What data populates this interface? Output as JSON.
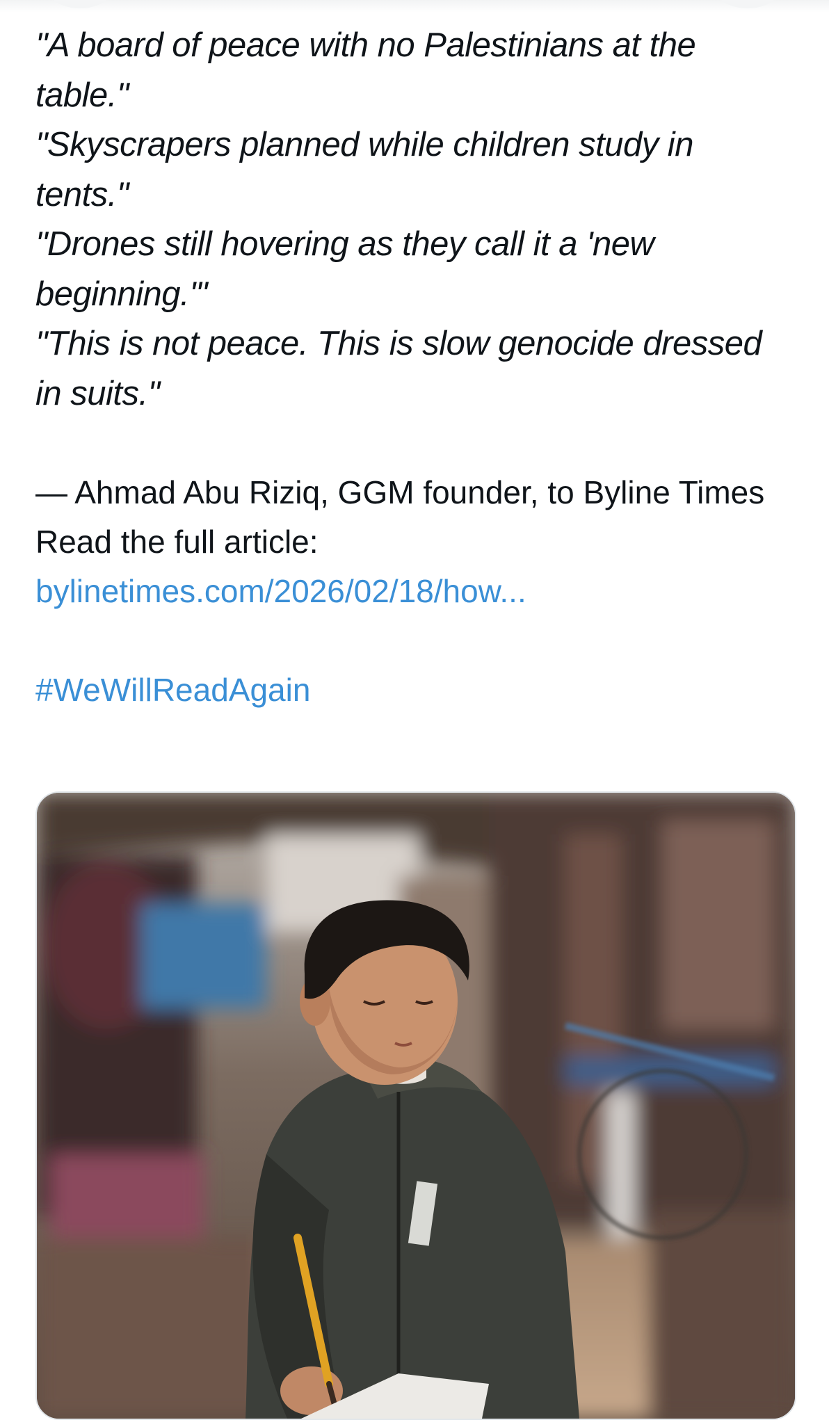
{
  "tweet": {
    "quotes": [
      "\"A board of peace with no Palestinians at the table.\"",
      "\"Skyscrapers planned while children study in tents.\"",
      "\"Drones still hovering as they call it a 'new beginning.'\"",
      "\"This is not peace. This is slow genocide dressed in suits.\""
    ],
    "attribution": "— Ahmad Abu Riziq, GGM founder, to Byline Times",
    "read_full": "Read the full article:",
    "link": "bylinetimes.com/2026/02/18/how...",
    "hashtag": "#WeWillReadAgain"
  },
  "media": {
    "kind": "photo"
  },
  "colors": {
    "link": "#3a8fd6",
    "text": "#0f1419"
  }
}
